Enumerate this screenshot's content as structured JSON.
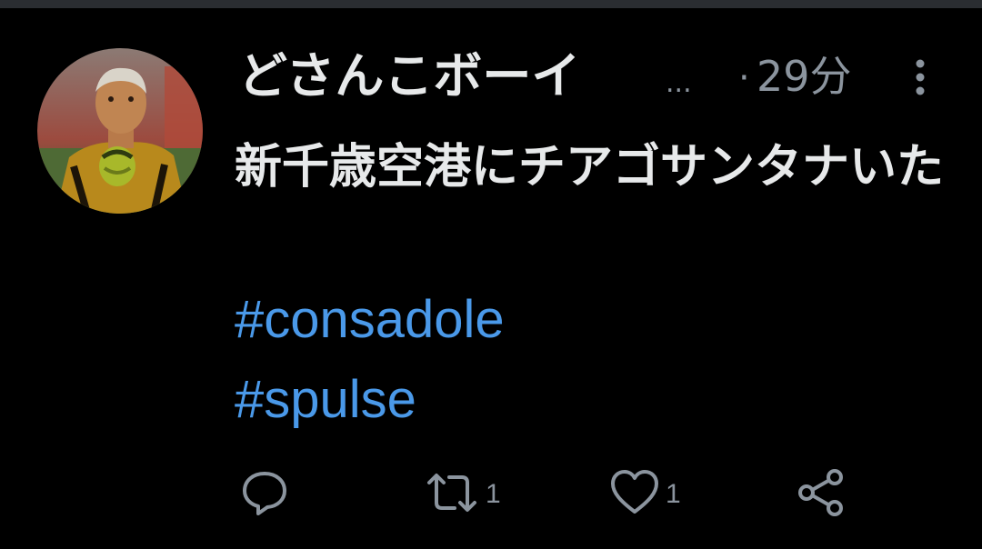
{
  "tweet": {
    "display_name": "どさんこボーイ",
    "truncation": "...",
    "separator": "·",
    "timestamp": "29分",
    "text": "新千歳空港にチアゴサンタナいた",
    "hashtags": [
      "#consadole",
      "#spulse"
    ]
  },
  "actions": {
    "reply": {
      "icon": "reply-icon"
    },
    "retweet": {
      "icon": "retweet-icon",
      "count": "1"
    },
    "like": {
      "icon": "heart-icon",
      "count": "1"
    },
    "share": {
      "icon": "share-icon"
    }
  },
  "colors": {
    "background": "#000000",
    "text": "#e7e9ea",
    "muted": "#8b949e",
    "link": "#4a99e9"
  }
}
